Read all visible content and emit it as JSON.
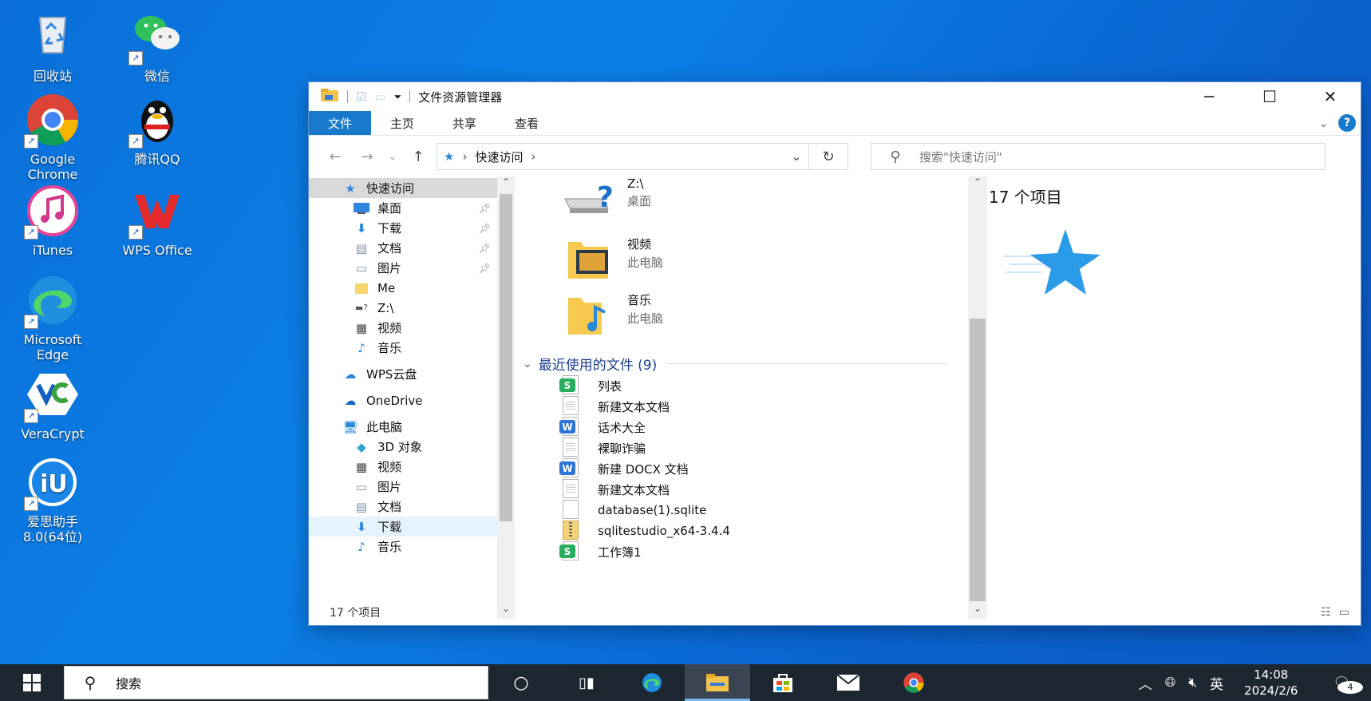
{
  "desktop": {
    "icons": [
      {
        "label": "回收站"
      },
      {
        "label": "微信"
      },
      {
        "label": "Google Chrome"
      },
      {
        "label": "腾讯QQ"
      },
      {
        "label": "iTunes"
      },
      {
        "label": "WPS Office"
      },
      {
        "label": "Microsoft Edge"
      },
      {
        "label": "VeraCrypt"
      },
      {
        "label": "爱思助手8.0(64位)"
      }
    ]
  },
  "window": {
    "title": "文件资源管理器",
    "controls": {
      "minimize": "─",
      "maximize": "☐",
      "close": "✕"
    },
    "ribbon_tabs": [
      "文件",
      "主页",
      "共享",
      "查看"
    ],
    "help": "?",
    "address": {
      "root": "快速访问"
    },
    "search_placeholder": "搜索\"快速访问\"",
    "nav": {
      "quick_access": "快速访问",
      "items": [
        "桌面",
        "下载",
        "文档",
        "图片",
        "Me",
        "Z:\\",
        "视频",
        "音乐"
      ],
      "wps": "WPS云盘",
      "onedrive": "OneDrive",
      "this_pc": "此电脑",
      "pc_items": [
        "3D 对象",
        "视频",
        "图片",
        "文档",
        "下载",
        "音乐"
      ]
    },
    "content": {
      "frequent": [
        {
          "name": "Z:\\",
          "location": "桌面"
        },
        {
          "name": "视频",
          "location": "此电脑"
        },
        {
          "name": "音乐",
          "location": "此电脑"
        }
      ],
      "recent_header": "最近使用的文件 (9)",
      "recent_files": [
        {
          "name": "列表",
          "icon": "wps-sheet"
        },
        {
          "name": "新建文本文档",
          "icon": "text"
        },
        {
          "name": "话术大全",
          "icon": "wps-doc"
        },
        {
          "name": "裸聊诈骗",
          "icon": "text"
        },
        {
          "name": "新建 DOCX 文档",
          "icon": "wps-doc"
        },
        {
          "name": "新建文本文档",
          "icon": "text"
        },
        {
          "name": "database(1).sqlite",
          "icon": "blank"
        },
        {
          "name": "sqlitestudio_x64-3.4.4",
          "icon": "zip"
        },
        {
          "name": "工作簿1",
          "icon": "wps-sheet"
        }
      ]
    },
    "preview_count": "17 个项目",
    "status": "17 个项目"
  },
  "taskbar": {
    "search_placeholder": "搜索",
    "ime": "英",
    "time": "14:08",
    "date": "2024/2/6",
    "notifications": "4"
  }
}
